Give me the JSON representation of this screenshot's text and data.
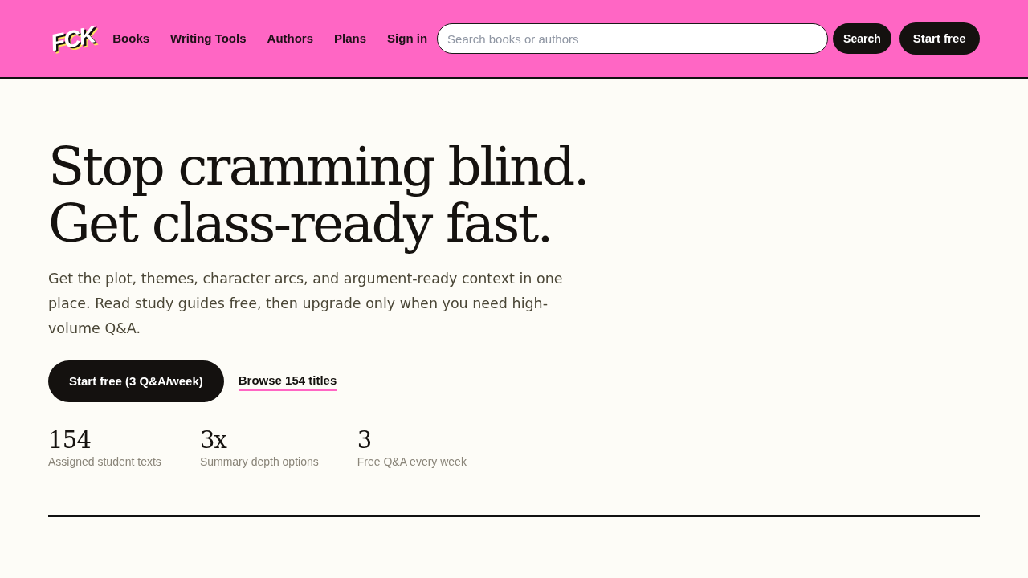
{
  "header": {
    "logo": "FCK",
    "nav": [
      "Books",
      "Writing Tools",
      "Authors",
      "Plans",
      "Sign in"
    ],
    "search": {
      "placeholder": "Search books or authors",
      "button": "Search"
    },
    "cta": "Start free"
  },
  "hero": {
    "title_lines": [
      "Stop cramming blind.",
      "Get class-ready fast."
    ],
    "description": "Get the plot, themes, character arcs, and argument-ready context in one place. Read study guides free, then upgrade only when you need high-volume Q&A.",
    "primary_button": "Start free (3 Q&A/week)",
    "link": "Browse 154 titles"
  },
  "stats": [
    {
      "value": "154",
      "label": "Assigned student texts"
    },
    {
      "value": "3x",
      "label": "Summary depth options"
    },
    {
      "value": "3",
      "label": "Free Q&A every week"
    }
  ]
}
